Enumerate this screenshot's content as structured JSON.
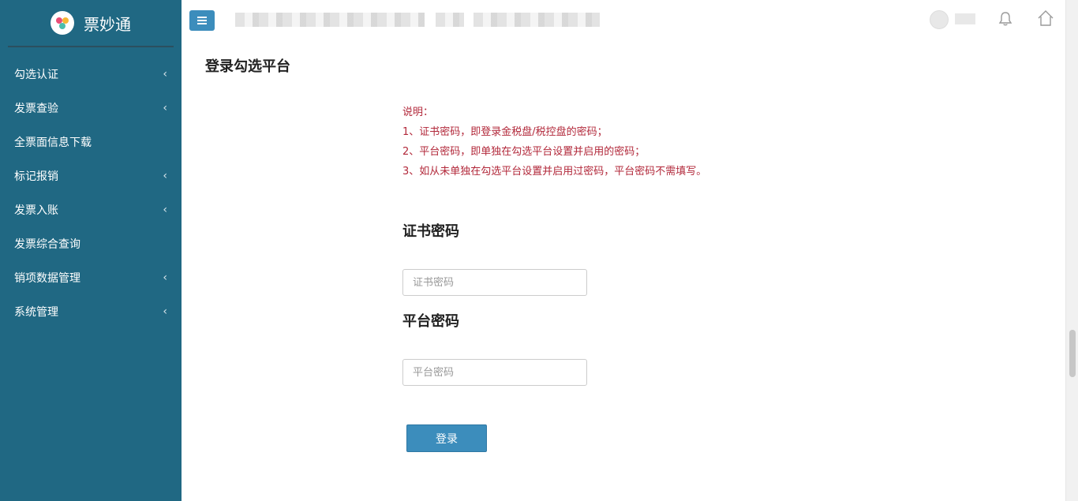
{
  "sidebar": {
    "brand": "票妙通",
    "items": [
      {
        "label": "勾选认证",
        "chevron": "‹"
      },
      {
        "label": "发票查验",
        "chevron": "‹"
      },
      {
        "label": "全票面信息下载",
        "chevron": ""
      },
      {
        "label": "标记报销",
        "chevron": "‹"
      },
      {
        "label": "发票入账",
        "chevron": "‹"
      },
      {
        "label": "发票综合查询",
        "chevron": ""
      },
      {
        "label": "销项数据管理",
        "chevron": "‹"
      },
      {
        "label": "系统管理",
        "chevron": "‹"
      }
    ]
  },
  "header": {
    "icons": [
      "menu-icon",
      "avatar",
      "bell-icon",
      "home-icon"
    ]
  },
  "main": {
    "title": "登录勾选平台",
    "notes": [
      "说明：",
      "1、证书密码，即登录金税盘/税控盘的密码；",
      "2、平台密码，即单独在勾选平台设置并启用的密码；",
      "3、如从未单独在勾选平台设置并启用过密码，平台密码不需填写。"
    ],
    "cert": {
      "label": "证书密码",
      "placeholder": "证书密码",
      "value": ""
    },
    "platform": {
      "label": "平台密码",
      "placeholder": "平台密码",
      "value": ""
    },
    "login_button": "登录"
  },
  "colors": {
    "sidebar": "#206883",
    "accent": "#3c8dbc",
    "notes": "#b2283a"
  }
}
